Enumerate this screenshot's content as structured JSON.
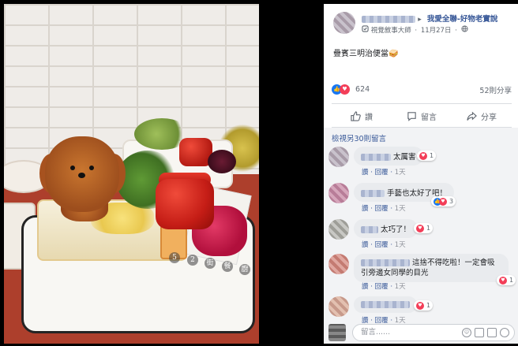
{
  "post": {
    "group_name": "我愛全聯-好物老實說",
    "badge_label": "視覺敘事大師",
    "date": "11月27日",
    "caption": "疊賓三明治便當",
    "caption_emoji": "🥪",
    "reactions_count": "624",
    "shares_label": "52則分享"
  },
  "actions": [
    {
      "label": "讚",
      "icon": "thumbs-up-icon"
    },
    {
      "label": "留言",
      "icon": "comment-icon"
    },
    {
      "label": "分享",
      "icon": "share-icon"
    }
  ],
  "comments": {
    "view_more": "檢視另30則留言",
    "items": [
      {
        "text": "太厲害",
        "like": "讚",
        "reply": "回覆",
        "time": "1天",
        "reactions": "1"
      },
      {
        "text": "手藝也太好了吧！",
        "like": "讚",
        "reply": "回覆",
        "time": "1天",
        "reactions": "3"
      },
      {
        "text": "太巧了！",
        "like": "讚",
        "reply": "回覆",
        "time": "1天",
        "reactions": "1"
      },
      {
        "text": "這捨不得吃啦！一定會吸引旁邊女同學的目光",
        "like": "讚",
        "reply": "回覆",
        "time": "1天",
        "reactions": "1"
      },
      {
        "text": "",
        "like": "讚",
        "reply": "回覆",
        "time": "1天",
        "reactions": "1"
      }
    ]
  },
  "composer": {
    "placeholder": "留言......"
  },
  "photo_watermark": [
    "5",
    "2",
    "街",
    "餐",
    "廚"
  ],
  "colors": {
    "link": "#385898",
    "like_blue": "#1877f2",
    "love_red": "#f33e58",
    "comment_bg": "#f2f3f5"
  }
}
